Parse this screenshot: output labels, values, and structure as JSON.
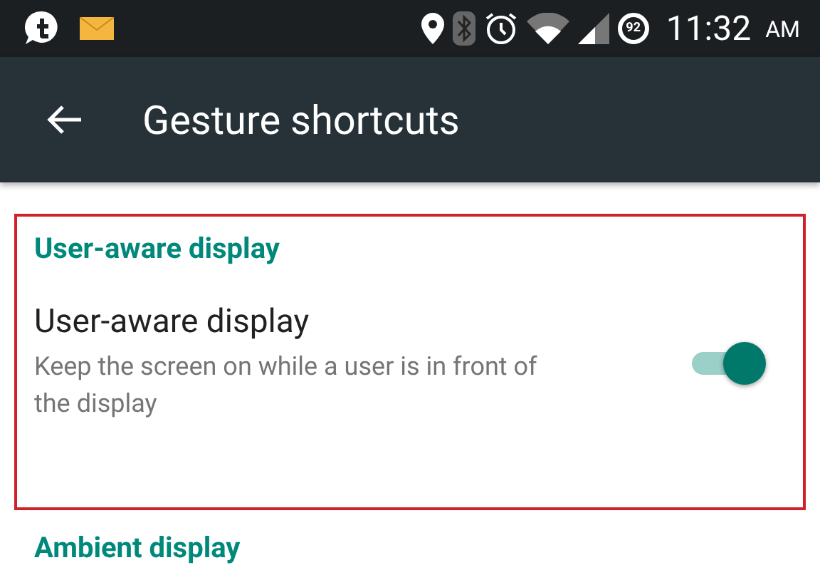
{
  "status_bar": {
    "battery": "92",
    "time": "11:32",
    "meridiem": "AM"
  },
  "app_bar": {
    "title": "Gesture shortcuts"
  },
  "sections": [
    {
      "header": "User-aware display",
      "highlighted": true,
      "items": [
        {
          "title": "User-aware display",
          "summary": "Keep the screen on while a user is in front of the display",
          "checked": true
        }
      ]
    },
    {
      "header": "Ambient display",
      "highlighted": false
    }
  ]
}
